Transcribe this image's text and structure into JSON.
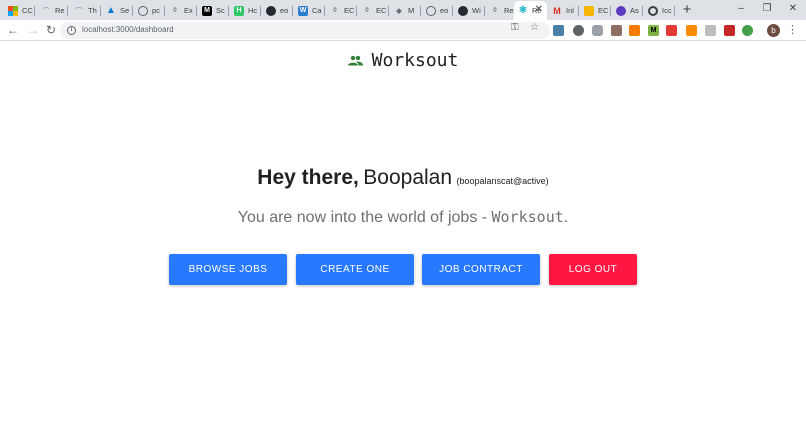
{
  "browser": {
    "tabs": [
      {
        "label": "CC",
        "icon": "microsoft-icon"
      },
      {
        "label": "Re",
        "icon": "page-icon"
      },
      {
        "label": "Th",
        "icon": "page-icon"
      },
      {
        "label": "Se",
        "icon": "azure-icon"
      },
      {
        "label": "pc",
        "icon": "globe-icon"
      },
      {
        "label": "Ex",
        "icon": "electron-icon"
      },
      {
        "label": "Sc",
        "icon": "medium-icon"
      },
      {
        "label": "Hc",
        "icon": "hackerrank-icon"
      },
      {
        "label": "eo",
        "icon": "github-icon"
      },
      {
        "label": "Ca",
        "icon": "word-icon"
      },
      {
        "label": "EC",
        "icon": "electron-icon"
      },
      {
        "label": "EC",
        "icon": "electron-icon"
      },
      {
        "label": "M",
        "icon": "diamond-icon"
      },
      {
        "label": "eo",
        "icon": "globe-icon"
      },
      {
        "label": "Wi",
        "icon": "github-icon"
      },
      {
        "label": "Re",
        "icon": "electron-icon"
      },
      {
        "label": "Re",
        "icon": "react-icon",
        "active": true
      },
      {
        "label": "Inl",
        "icon": "gmail-icon"
      },
      {
        "label": "EC",
        "icon": "slides-icon"
      },
      {
        "label": "As",
        "icon": "asana-icon"
      },
      {
        "label": "Icc",
        "icon": "lifebuoy-icon"
      }
    ],
    "new_tab": "+",
    "window": {
      "minimize": "–",
      "restore": "❐",
      "close": "✕"
    },
    "url": "localhost:3000/dashboard",
    "avatar_letter": "b"
  },
  "app": {
    "brand": "Worksout",
    "greeting": {
      "hey": "Hey there,",
      "name": "Boopalan",
      "handle": "(boopalanscat@active)"
    },
    "tagline": {
      "prefix": "You are now into the world of jobs - ",
      "brand": "Worksout",
      "suffix": "."
    },
    "buttons": {
      "browse": "BROWSE JOBS",
      "create": "CREATE ONE",
      "contract": "JOB CONTRACT",
      "logout": "LOG OUT"
    }
  },
  "colors": {
    "primary": "#2979ff",
    "danger": "#ff1744",
    "brand_icon": "#2e7d32"
  }
}
